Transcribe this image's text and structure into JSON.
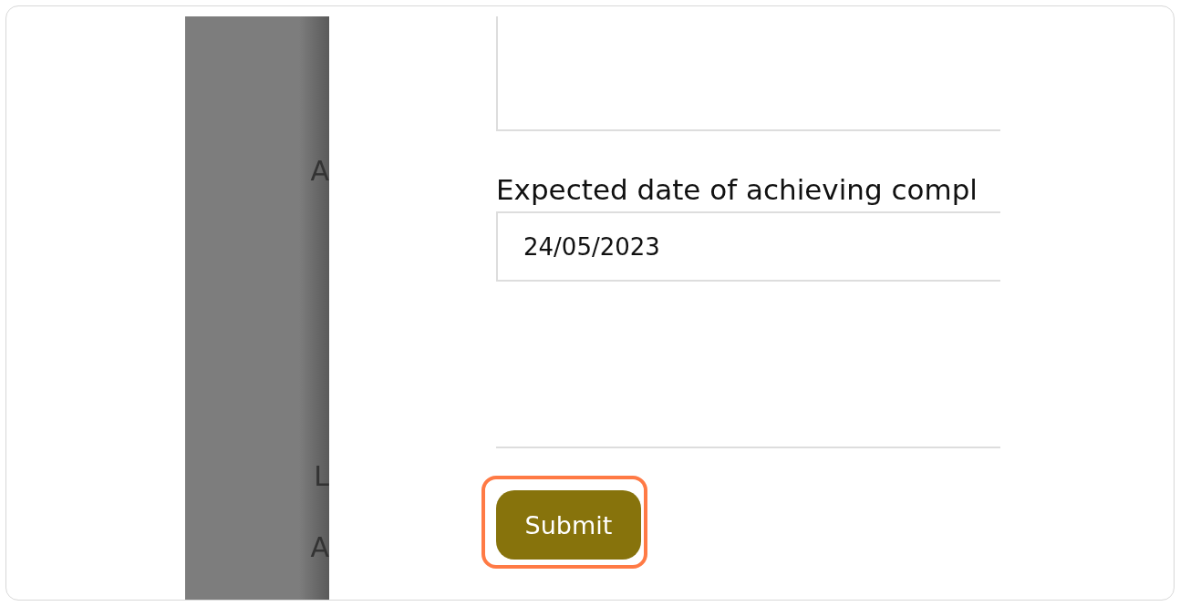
{
  "side_panel": {
    "letters": [
      "A",
      "L",
      "A"
    ]
  },
  "form": {
    "date_label": "Expected date of achieving compl",
    "date_field": {
      "value": "24/05/2023"
    },
    "submit_button": {
      "label": "Submit",
      "highlighted": true
    }
  }
}
